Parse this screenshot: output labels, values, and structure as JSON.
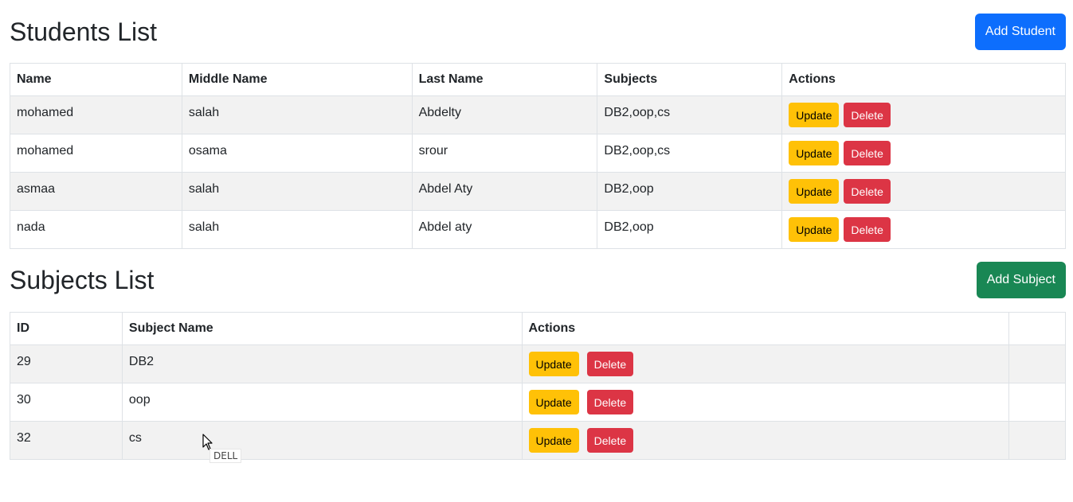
{
  "students": {
    "title": "Students List",
    "add_button": "Add Student",
    "columns": [
      "Name",
      "Middle Name",
      "Last Name",
      "Subjects",
      "Actions"
    ],
    "rows": [
      {
        "name": "mohamed",
        "middle": "salah",
        "last": "Abdelty",
        "subjects": "DB2,oop,cs"
      },
      {
        "name": "mohamed",
        "middle": "osama",
        "last": "srour",
        "subjects": "DB2,oop,cs"
      },
      {
        "name": "asmaa",
        "middle": "salah",
        "last": "Abdel Aty",
        "subjects": "DB2,oop"
      },
      {
        "name": "nada",
        "middle": "salah",
        "last": "Abdel aty",
        "subjects": "DB2,oop"
      }
    ],
    "update_label": "Update",
    "delete_label": "Delete"
  },
  "subjects": {
    "title": "Subjects List",
    "add_button": "Add Subject",
    "columns": [
      "ID",
      "Subject Name",
      "Actions",
      ""
    ],
    "rows": [
      {
        "id": "29",
        "name": "DB2"
      },
      {
        "id": "30",
        "name": "oop"
      },
      {
        "id": "32",
        "name": "cs"
      }
    ],
    "update_label": "Update",
    "delete_label": "Delete"
  },
  "tooltip": {
    "text": "DELL"
  },
  "colors": {
    "primary": "#0d6efd",
    "success": "#198754",
    "warning": "#ffc107",
    "danger": "#dc3545",
    "striped_row": "#f2f2f2"
  },
  "icons": {
    "cursor": "mouse-pointer-icon"
  }
}
